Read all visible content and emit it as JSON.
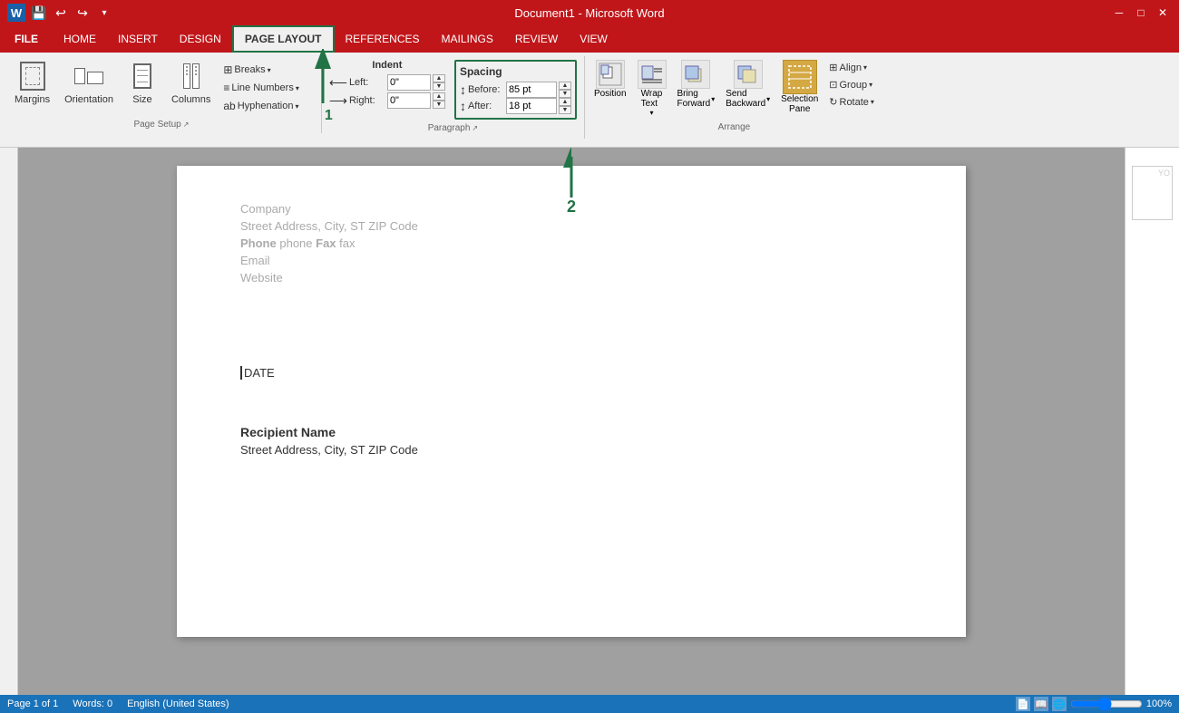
{
  "titlebar": {
    "title": "Document1 - Microsoft Word",
    "quicksave": "💾",
    "undo": "↩",
    "redo": "↪"
  },
  "menubar": {
    "items": [
      {
        "label": "FILE",
        "type": "file"
      },
      {
        "label": "HOME",
        "type": "normal"
      },
      {
        "label": "INSERT",
        "type": "normal"
      },
      {
        "label": "DESIGN",
        "type": "normal"
      },
      {
        "label": "PAGE LAYOUT",
        "type": "active"
      },
      {
        "label": "REFERENCES",
        "type": "normal"
      },
      {
        "label": "MAILINGS",
        "type": "normal"
      },
      {
        "label": "REVIEW",
        "type": "normal"
      },
      {
        "label": "VIEW",
        "type": "normal"
      }
    ]
  },
  "ribbon": {
    "groups": {
      "pagesetup": {
        "label": "Page Setup",
        "buttons": {
          "margins": "Margins",
          "orientation": "Orientation",
          "size": "Size",
          "columns": "Columns",
          "breaks": "Breaks",
          "line_numbers": "Line Numbers",
          "hyphenation": "Hyphenation"
        }
      },
      "paragraph": {
        "label": "Paragraph",
        "indent": {
          "title": "Indent",
          "left_label": "Left:",
          "left_value": "0\"",
          "right_label": "Right:",
          "right_value": "0\""
        },
        "spacing": {
          "title": "Spacing",
          "before_label": "Before:",
          "before_value": "85 pt",
          "after_label": "After:",
          "after_value": "18 pt"
        }
      },
      "arrange": {
        "label": "Arrange",
        "buttons": {
          "position": "Position",
          "wrap_text": "Wrap\nText",
          "bring_forward": "Bring\nForward",
          "send_backward": "Send\nBackward",
          "selection_pane": "Selection\nPane",
          "align": "Align",
          "group": "Group",
          "rotate": "Rotate"
        }
      }
    }
  },
  "document": {
    "company": "Company",
    "address": "Street Address, City, ST ZIP Code",
    "contact": "Phone phone  Fax fax",
    "email": "Email",
    "website": "Website",
    "date": "DATE",
    "recipient_name": "Recipient Name",
    "recipient_address": "Street Address, City, ST ZIP Code"
  },
  "annotations": {
    "arrow1_label": "1",
    "arrow2_label": "2"
  },
  "statusbar": {
    "page": "Page 1 of 1",
    "words": "Words: 0",
    "language": "English (United States)"
  }
}
